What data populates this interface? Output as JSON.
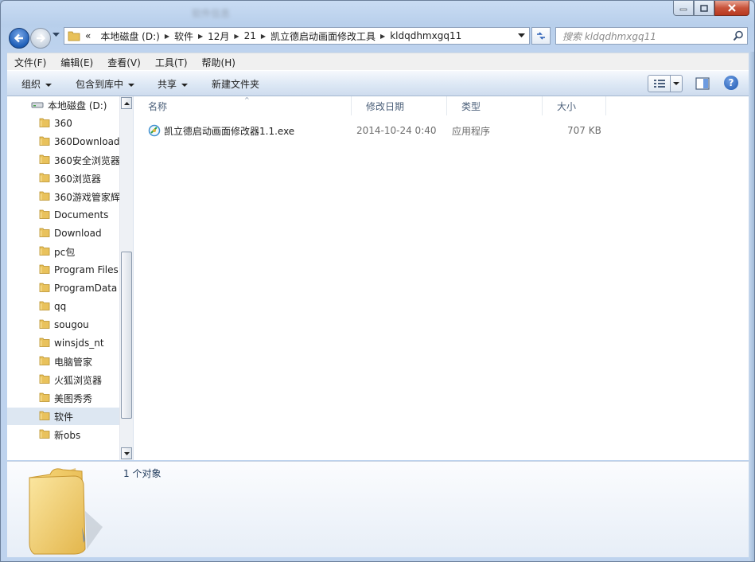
{
  "window": {
    "title": "软件信息"
  },
  "address": {
    "overflow": "«",
    "segments": [
      "本地磁盘 (D:)",
      "软件",
      "12月",
      "21",
      "凯立德启动画面修改工具",
      "kldqdhmxgq11"
    ]
  },
  "search": {
    "placeholder": "搜索 kldqdhmxgq11"
  },
  "menu": [
    "文件(F)",
    "编辑(E)",
    "查看(V)",
    "工具(T)",
    "帮助(H)"
  ],
  "toolbar": {
    "organize": "组织",
    "include_library": "包含到库中",
    "share": "共享",
    "new_folder": "新建文件夹"
  },
  "nav": {
    "drive": "本地磁盘 (D:)",
    "items": [
      "360",
      "360Download",
      "360安全浏览器",
      "360浏览器",
      "360游戏管家辉",
      "Documents",
      "Download",
      "pc包",
      "Program Files",
      "ProgramData",
      "qq",
      "sougou",
      "winsjds_nt",
      "电脑管家",
      "火狐浏览器",
      "美图秀秀",
      "软件",
      "新obs"
    ],
    "selected": "软件"
  },
  "columns": {
    "name": "名称",
    "date": "修改日期",
    "type": "类型",
    "size": "大小"
  },
  "files": [
    {
      "name": "凯立德启动画面修改器1.1.exe",
      "date": "2014-10-24 0:40",
      "type": "应用程序",
      "size": "707 KB"
    }
  ],
  "details": {
    "count": "1 个对象"
  }
}
